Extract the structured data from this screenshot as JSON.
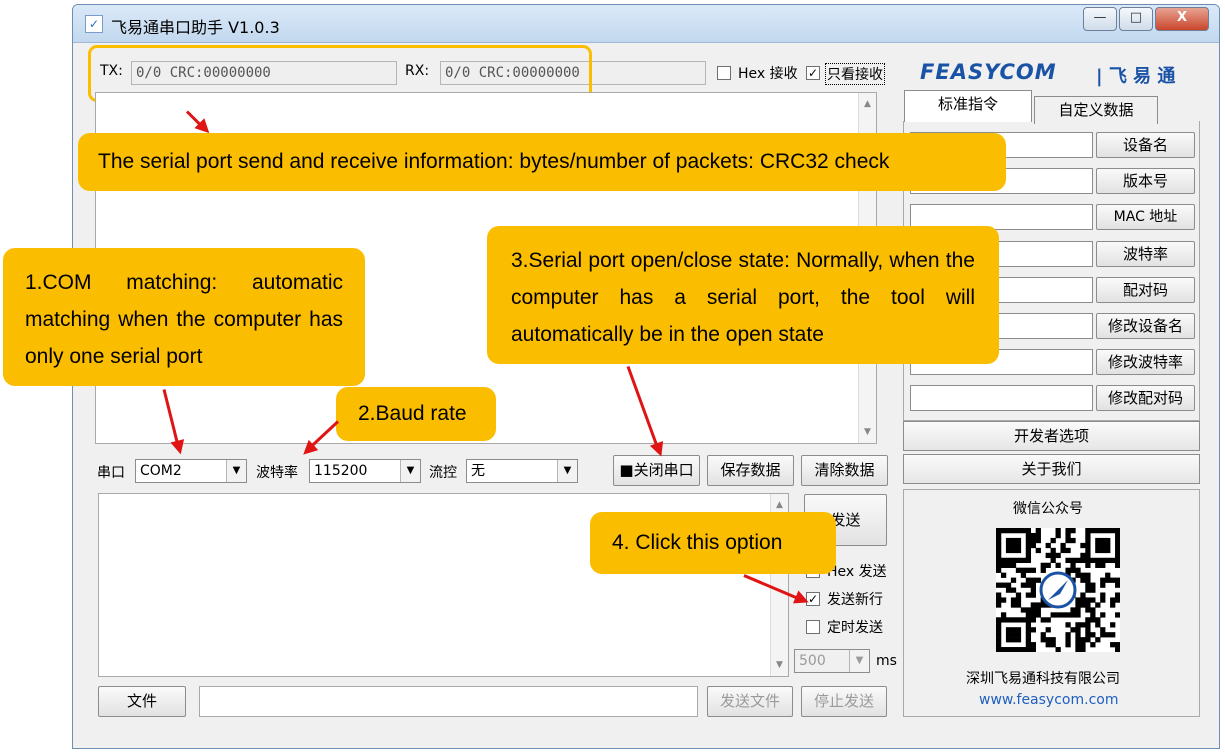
{
  "window": {
    "title": "飞易通串口助手 V1.0.3"
  },
  "title_buttons": {
    "minimize": "—",
    "maximize": "□",
    "close": "X"
  },
  "status": {
    "tx_label": "TX:",
    "tx_value": "0/0 CRC:00000000",
    "rx_label": "RX:",
    "rx_value": "0/0 CRC:00000000"
  },
  "receive_options": {
    "hex_receive": "Hex 接收",
    "view_only": "只看接收",
    "hex_receive_checked": false,
    "view_only_checked": true
  },
  "brand": {
    "logo": "FEASYCOM",
    "chinese": "| 飞 易 通"
  },
  "tabs": {
    "standard": "标准指令",
    "custom": "自定义数据"
  },
  "commands": [
    "设备名",
    "版本号",
    "MAC 地址",
    "波特率",
    "配对码",
    "修改设备名",
    "修改波特率",
    "修改配对码"
  ],
  "side_buttons": {
    "developer": "开发者选项",
    "about": "关于我们"
  },
  "wechat": {
    "title": "微信公众号",
    "company": "深圳飞易通科技有限公司",
    "url": "www.feasycom.com"
  },
  "port_bar": {
    "port_label": "串口",
    "port_value": "COM2",
    "baud_label": "波特率",
    "baud_value": "115200",
    "flow_label": "流控",
    "flow_value": "无",
    "close_port": "■关闭串口",
    "save_data": "保存数据",
    "clear_data": "清除数据"
  },
  "send_area": {
    "send_button": "发送",
    "hex_send": "Hex 发送",
    "send_newline": "发送新行",
    "timed_send": "定时发送",
    "hex_send_checked": false,
    "send_newline_checked": true,
    "timed_send_checked": false,
    "interval_value": "500",
    "interval_unit": "ms"
  },
  "file_bar": {
    "file_button": "文件",
    "send_file": "发送文件",
    "stop_send": "停止发送"
  },
  "callouts": {
    "status_info": "The serial port send and receive information: bytes/number of packets: CRC32 check",
    "com_matching": "1.COM matching: automatic matching when the computer has only one serial port",
    "baud_rate": "2.Baud rate",
    "port_state": "3.Serial port open/close state: Normally, when the computer has a serial port, the tool will automatically be in the open state",
    "click_option": "4. Click this option"
  },
  "colors": {
    "callout": "#fbbd00",
    "highlight_border": "#fbbd00",
    "arrow": "#e01414",
    "brand_blue": "#1a53a6",
    "link": "#1f5fbf"
  }
}
